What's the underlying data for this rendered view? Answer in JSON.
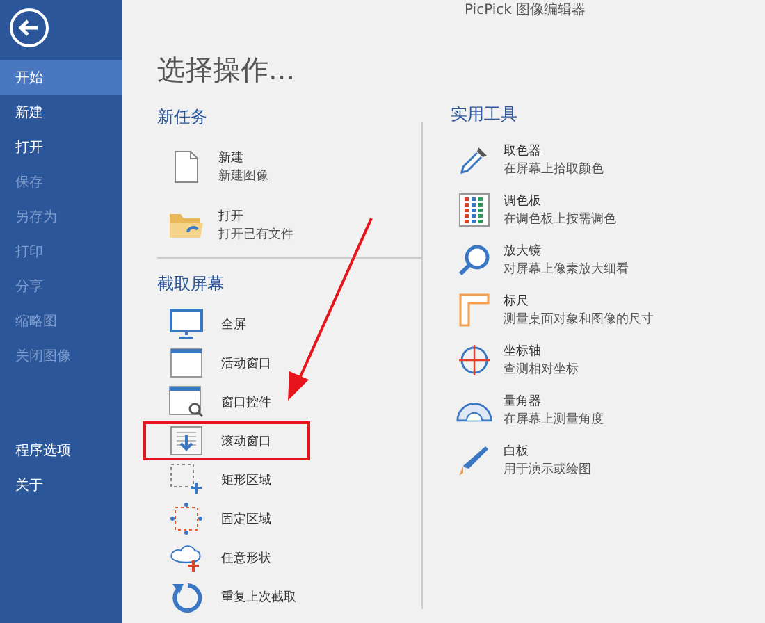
{
  "app_title": "PicPick 图像编辑器",
  "sidebar": {
    "items": [
      {
        "label": "开始",
        "selected": true,
        "disabled": false
      },
      {
        "label": "新建",
        "selected": false,
        "disabled": false
      },
      {
        "label": "打开",
        "selected": false,
        "disabled": false
      },
      {
        "label": "保存",
        "selected": false,
        "disabled": true
      },
      {
        "label": "另存为",
        "selected": false,
        "disabled": true
      },
      {
        "label": "打印",
        "selected": false,
        "disabled": true
      },
      {
        "label": "分享",
        "selected": false,
        "disabled": true
      },
      {
        "label": "缩略图",
        "selected": false,
        "disabled": true
      },
      {
        "label": "关闭图像",
        "selected": false,
        "disabled": true
      }
    ],
    "bottom_items": [
      {
        "label": "程序选项",
        "selected": false,
        "disabled": false
      },
      {
        "label": "关于",
        "selected": false,
        "disabled": false
      }
    ]
  },
  "heading": "选择操作...",
  "new_task": {
    "title": "新任务",
    "items": [
      {
        "kind": "new",
        "title": "新建",
        "subtitle": "新建图像"
      },
      {
        "kind": "open",
        "title": "打开",
        "subtitle": "打开已有文件"
      }
    ]
  },
  "capture": {
    "title": "截取屏幕",
    "items": [
      {
        "kind": "fullscreen",
        "label": "全屏",
        "highlighted": false
      },
      {
        "kind": "window",
        "label": "活动窗口",
        "highlighted": false
      },
      {
        "kind": "control",
        "label": "窗口控件",
        "highlighted": false
      },
      {
        "kind": "scroll",
        "label": "滚动窗口",
        "highlighted": true
      },
      {
        "kind": "region",
        "label": "矩形区域",
        "highlighted": false
      },
      {
        "kind": "fixed",
        "label": "固定区域",
        "highlighted": false
      },
      {
        "kind": "freehand",
        "label": "任意形状",
        "highlighted": false
      },
      {
        "kind": "repeat",
        "label": "重复上次截取",
        "highlighted": false
      }
    ]
  },
  "tools": {
    "title": "实用工具",
    "items": [
      {
        "kind": "picker",
        "title": "取色器",
        "subtitle": "在屏幕上拾取颜色"
      },
      {
        "kind": "palette",
        "title": "调色板",
        "subtitle": "在调色板上按需调色"
      },
      {
        "kind": "magnifier",
        "title": "放大镜",
        "subtitle": "对屏幕上像素放大细看"
      },
      {
        "kind": "ruler",
        "title": "标尺",
        "subtitle": "测量桌面对象和图像的尺寸"
      },
      {
        "kind": "crosshair",
        "title": "坐标轴",
        "subtitle": "查测相对坐标"
      },
      {
        "kind": "protractor",
        "title": "量角器",
        "subtitle": "在屏幕上测量角度"
      },
      {
        "kind": "whiteboard",
        "title": "白板",
        "subtitle": "用于演示或绘图"
      }
    ]
  }
}
